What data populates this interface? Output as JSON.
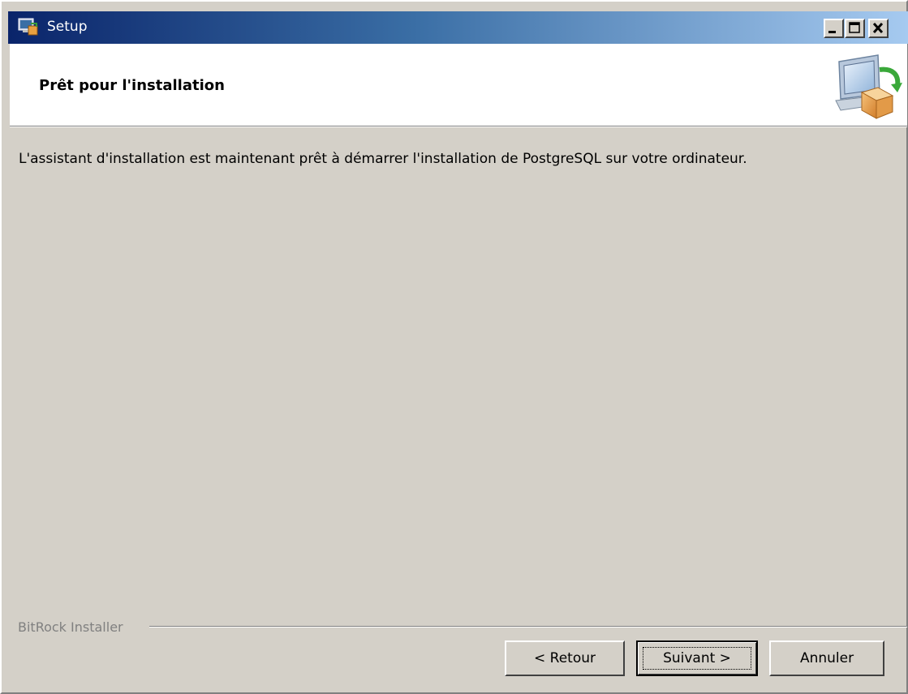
{
  "window": {
    "title": "Setup",
    "controls": {
      "minimize": "minimize-icon",
      "maximize": "maximize-icon",
      "close": "close-icon"
    }
  },
  "header": {
    "title": "Prêt pour l'installation",
    "icon": "installer-computer-box-icon"
  },
  "main": {
    "message": "L'assistant d'installation est maintenant prêt à démarrer l'installation de PostgreSQL sur votre ordinateur."
  },
  "footer": {
    "brand": "BitRock Installer",
    "buttons": {
      "back": "< Retour",
      "next": "Suivant >",
      "cancel": "Annuler"
    }
  },
  "colors": {
    "titlebar_start": "#0a246a",
    "titlebar_end": "#a6caf0",
    "dialog_bg": "#d4d0c8"
  }
}
